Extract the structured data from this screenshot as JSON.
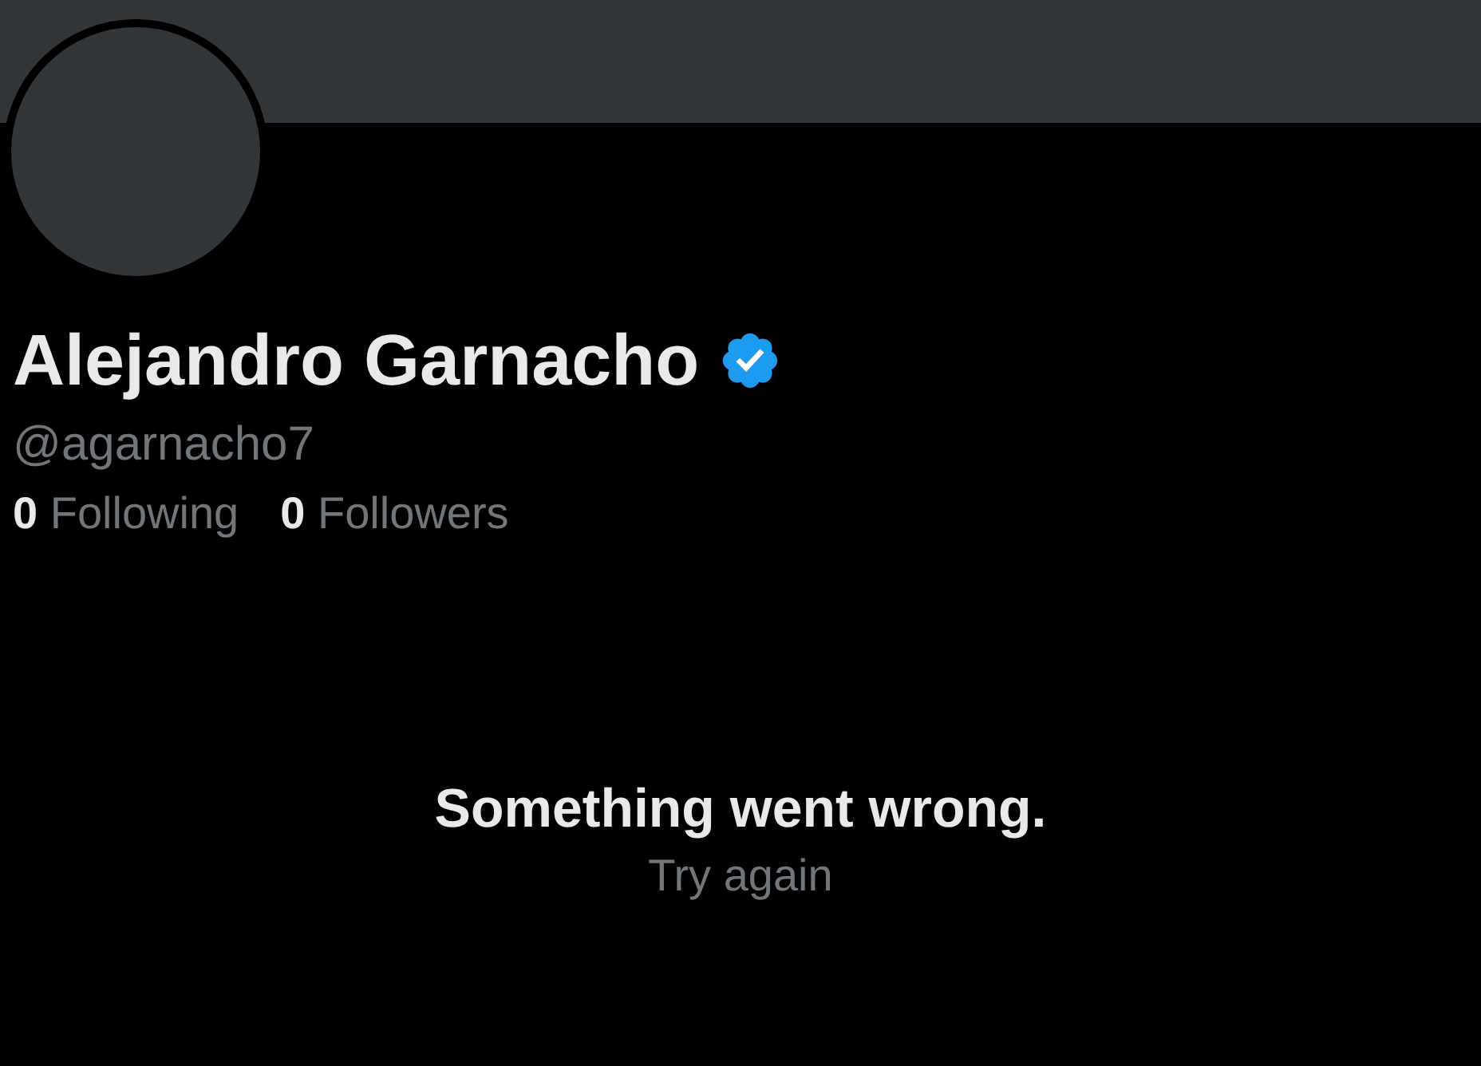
{
  "profile": {
    "name": "Alejandro Garnacho",
    "verified": true,
    "handle": "@agarnacho7",
    "stats": [
      {
        "count": "0",
        "label": "Following"
      },
      {
        "count": "0",
        "label": "Followers"
      }
    ]
  },
  "error": {
    "message": "Something went wrong.",
    "action": "Try again"
  }
}
